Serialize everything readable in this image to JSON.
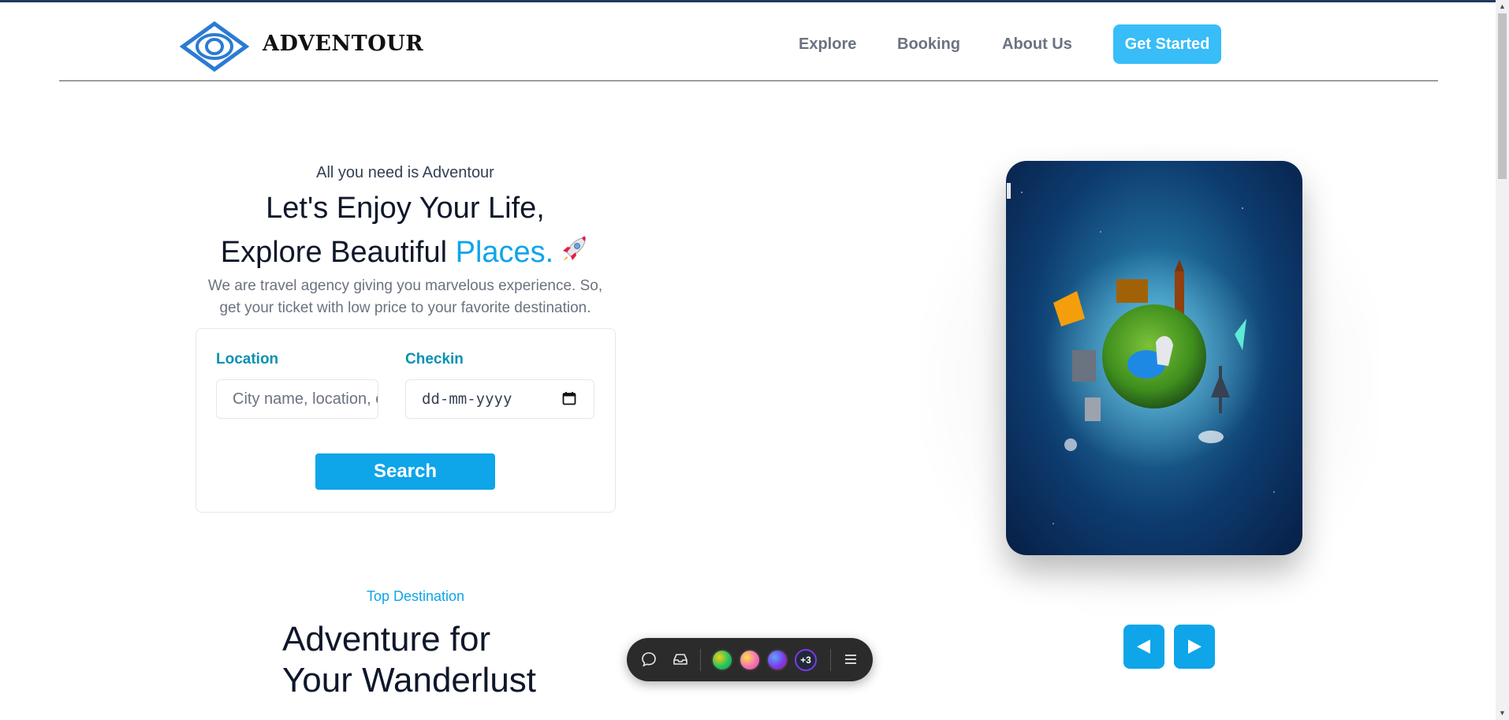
{
  "brand": {
    "name": "ADVENTOUR",
    "logo_icon": "eye-diamond-logo"
  },
  "nav": {
    "items": [
      {
        "label": "Explore"
      },
      {
        "label": "Booking"
      },
      {
        "label": "About Us"
      }
    ],
    "cta_label": "Get Started"
  },
  "hero": {
    "tagline": "All you need is Adventour",
    "title_line1": "Let's Enjoy Your Life,",
    "title_line2_prefix": "Explore Beautiful",
    "title_line2_accent": "Places.",
    "title_icon": "rocket-icon",
    "description": "We are travel agency giving you marvelous experience. So, get your ticket with low price to your favorite destination."
  },
  "search": {
    "location_label": "Location",
    "location_placeholder": "City name, location, or",
    "checkin_label": "Checkin",
    "checkin_placeholder": "dd-mm-yyyy",
    "button_label": "Search"
  },
  "carousel": {
    "prev_icon": "triangle-left-icon",
    "next_icon": "triangle-right-icon"
  },
  "section": {
    "kicker": "Top Destination",
    "title_line1": "Adventure for",
    "title_line2": "Your Wanderlust"
  },
  "toolbar": {
    "comment_icon": "comment-icon",
    "inbox_icon": "inbox-icon",
    "more_count": "+3",
    "menu_icon": "hamburger-menu-icon"
  },
  "colors": {
    "accent": "#0ea5e9",
    "cta": "#38bdf8",
    "label": "#0891b2",
    "toolbar": "#2b2b2b"
  }
}
